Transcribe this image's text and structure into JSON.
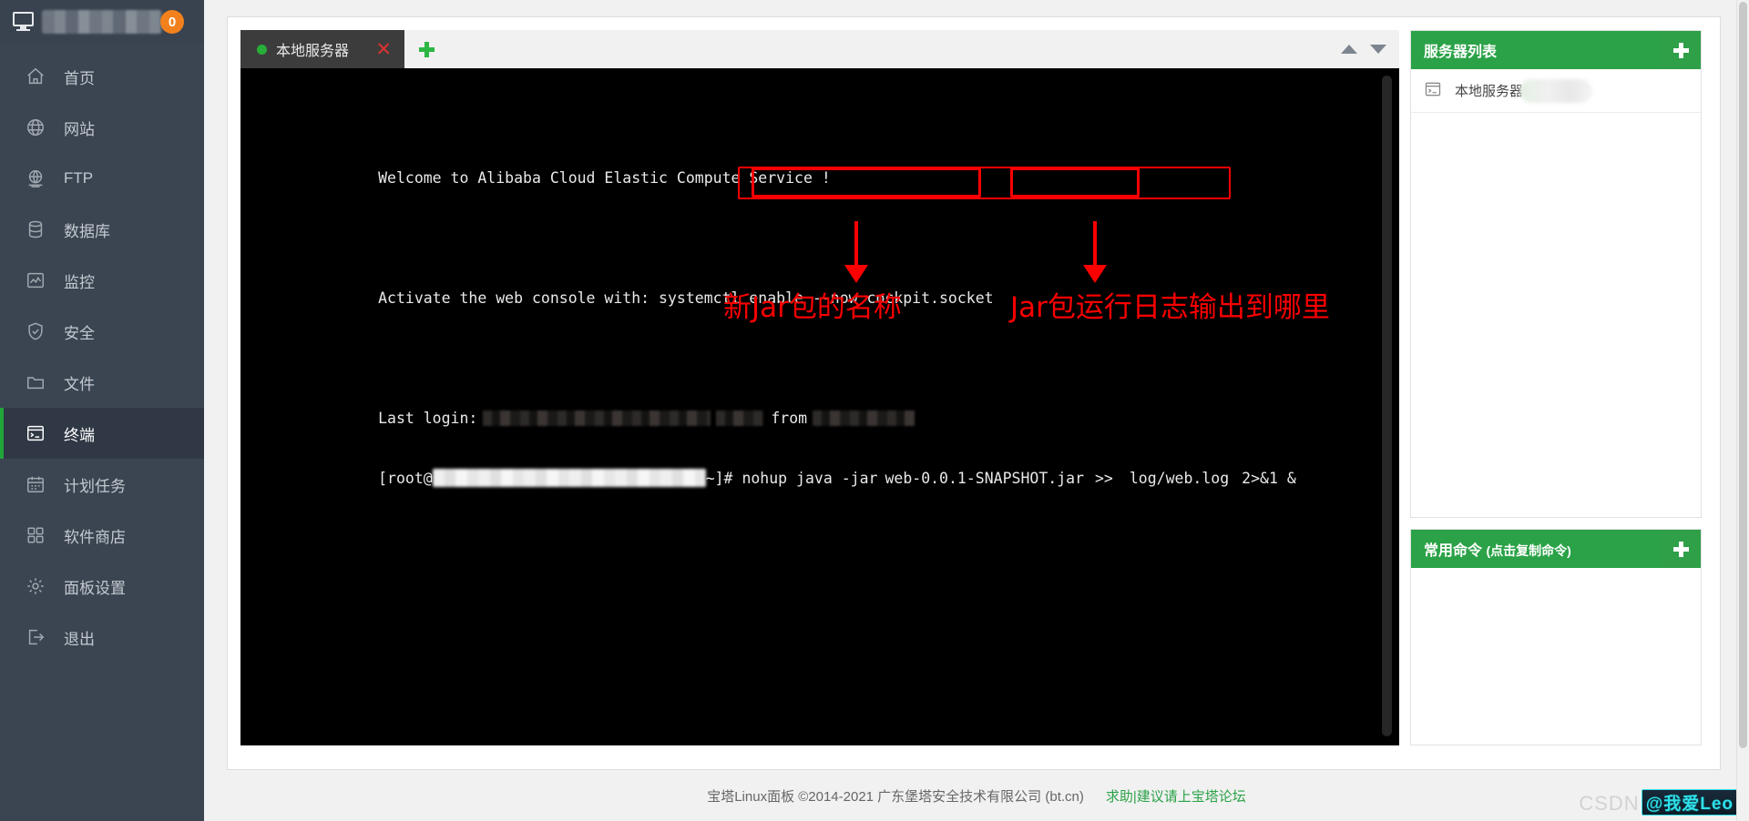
{
  "sidebar": {
    "header": {
      "icon": "monitor-icon",
      "redacted_title": true,
      "badge": "0"
    },
    "items": [
      {
        "label": "首页",
        "icon": "home-icon",
        "active": false
      },
      {
        "label": "网站",
        "icon": "globe-icon",
        "active": false
      },
      {
        "label": "FTP",
        "icon": "ftp-icon",
        "active": false
      },
      {
        "label": "数据库",
        "icon": "database-icon",
        "active": false
      },
      {
        "label": "监控",
        "icon": "monitor-chart-icon",
        "active": false
      },
      {
        "label": "安全",
        "icon": "shield-check-icon",
        "active": false
      },
      {
        "label": "文件",
        "icon": "folder-icon",
        "active": false
      },
      {
        "label": "终端",
        "icon": "terminal-icon",
        "active": true
      },
      {
        "label": "计划任务",
        "icon": "calendar-icon",
        "active": false
      },
      {
        "label": "软件商店",
        "icon": "grid-icon",
        "active": false
      },
      {
        "label": "面板设置",
        "icon": "gear-icon",
        "active": false
      },
      {
        "label": "退出",
        "icon": "logout-icon",
        "active": false
      }
    ]
  },
  "terminal": {
    "tab": {
      "label": "本地服务器",
      "status_dot_color": "#27ae38",
      "close_label": "✕"
    },
    "add_tab_label": "+",
    "scroll_up_label": "▲",
    "scroll_down_label": "▼",
    "lines": {
      "welcome": "Welcome to Alibaba Cloud Elastic Compute Service !",
      "activate": "Activate the web console with: systemctl enable --now cockpit.socket",
      "last_login_prefix": "Last login:",
      "last_login_from": "from",
      "prompt_prefix": "[root@",
      "prompt_suffix": "~]#",
      "cmd_head": "nohup java -jar",
      "cmd_jar": "web-0.0.1-SNAPSHOT.jar",
      "cmd_redirect": ">>",
      "cmd_log": "log/web.log",
      "cmd_tail": "2>&1 &"
    },
    "annotations": [
      {
        "text": "新Jar包的名称",
        "color": "#fb0000"
      },
      {
        "text": "Jar包运行日志输出到哪里",
        "color": "#fb0000"
      }
    ]
  },
  "server_panel": {
    "title": "服务器列表",
    "add_label": "+",
    "rows": [
      {
        "icon": "terminal-icon",
        "label": "本地服务器",
        "redacted": true
      }
    ]
  },
  "command_panel": {
    "title": "常用命令",
    "subtitle": "(点击复制命令)",
    "add_label": "+",
    "rows": []
  },
  "footer": {
    "copyright": "宝塔Linux面板 ©2014-2021 广东堡塔安全技术有限公司 (bt.cn)",
    "link": "求助|建议请上宝塔论坛"
  },
  "watermark": {
    "prefix": "CSDN",
    "handle": "@我爱Leo"
  },
  "colors": {
    "sidebar_bg": "#3b4551",
    "sidebar_active": "#2f3844",
    "accent_green": "#2ba247",
    "badge_orange": "#f2811d",
    "annotation_red": "#fb0000",
    "terminal_bg": "#000000"
  }
}
